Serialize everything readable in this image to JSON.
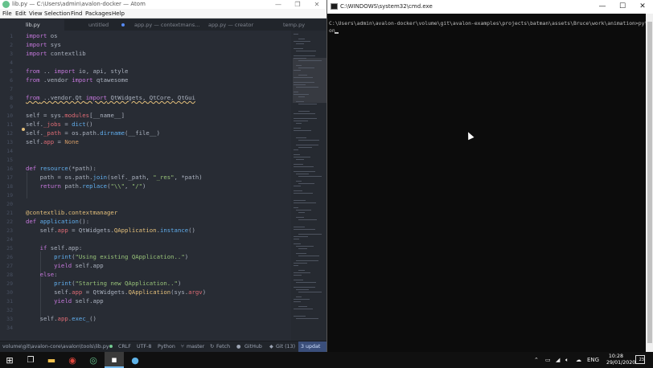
{
  "atom": {
    "title": "lib.py — C:\\Users\\admin\\avalon-docker — Atom",
    "window_controls": [
      "—",
      "❐",
      "✕"
    ],
    "menu": [
      "File",
      "Edit",
      "View",
      "Selection",
      "Find",
      "Packages",
      "Help"
    ],
    "tabs": [
      {
        "label": "lib.py",
        "active": true
      },
      {
        "label": "untitled",
        "active": false
      },
      {
        "label": "app.py — contextmans...",
        "active": false
      },
      {
        "label": "app.py — creator",
        "active": false
      },
      {
        "label": "temp.py",
        "active": false
      }
    ],
    "line_numbers": [
      "1",
      "2",
      "3",
      "4",
      "5",
      "6",
      "7",
      "8",
      "9",
      "10",
      "11",
      "12",
      "13",
      "14",
      "15",
      "16",
      "17",
      "18",
      "19",
      "20",
      "21",
      "22",
      "23",
      "24",
      "25",
      "26",
      "27",
      "28",
      "29",
      "30",
      "31",
      "32",
      "33",
      "34"
    ],
    "code": {
      "l1_kw": "import",
      "l1_rest": " os",
      "l2_kw": "import",
      "l2_rest": " sys",
      "l3_kw": "import",
      "l3_rest": " contextlib",
      "l5_kw1": "from",
      "l5_mid": " .. ",
      "l5_kw2": "import",
      "l5_rest": " io, api, style",
      "l6_kw1": "from",
      "l6_mid": " .vendor ",
      "l6_kw2": "import",
      "l6_rest": " qtawesome",
      "l8_kw1": "from",
      "l8_mid": " ..vendor.Qt ",
      "l8_kw2": "import",
      "l8_rest": " QtWidgets, QtCore, QtGui",
      "l10_a": "self = sys.",
      "l10_b": "modules",
      "l10_c": "[__name__]",
      "l11_a": "self.",
      "l11_b": "_jobs",
      "l11_c": " = ",
      "l11_d": "dict",
      "l11_e": "()",
      "l12_a": "self.",
      "l12_b": "_path",
      "l12_c": " = os.path.",
      "l12_d": "dirname",
      "l12_e": "(__file__)",
      "l13_a": "self.",
      "l13_b": "app",
      "l13_c": " = ",
      "l13_d": "None",
      "l16_kw": "def",
      "l16_fn": " resource",
      "l16_rest": "(*path):",
      "l17_a": "    path = os.path.",
      "l17_b": "join",
      "l17_c": "(self._path, ",
      "l17_d": "\"_res\"",
      "l17_e": ", *path)",
      "l18_kw": "    return",
      "l18_a": " path.",
      "l18_b": "replace",
      "l18_c": "(",
      "l18_d": "\"\\\\\"",
      "l18_e": ", ",
      "l18_f": "\"/\"",
      "l18_g": ")",
      "l21_a": "@contextlib.contextmanager",
      "l22_kw": "def",
      "l22_fn": " application",
      "l22_rest": "():",
      "l23_a": "    self.",
      "l23_b": "app",
      "l23_c": " = QtWidgets.",
      "l23_d": "QApplication",
      "l23_e": ".",
      "l23_f": "instance",
      "l23_g": "()",
      "l25_kw": "    if",
      "l25_rest": " self.app:",
      "l26_a": "        ",
      "l26_fn": "print",
      "l26_b": "(",
      "l26_s": "\"Using existing QApplication..\"",
      "l26_c": ")",
      "l27_kw": "        yield",
      "l27_rest": " self.app",
      "l28_kw": "    else",
      "l28_rest": ":",
      "l29_a": "        ",
      "l29_fn": "print",
      "l29_b": "(",
      "l29_s": "\"Starting new QApplication..\"",
      "l29_c": ")",
      "l30_a": "        self.",
      "l30_b": "app",
      "l30_c": " = QtWidgets.",
      "l30_d": "QApplication",
      "l30_e": "(sys.",
      "l30_f": "argv",
      "l30_g": ")",
      "l31_kw": "        yield",
      "l31_rest": " self.app",
      "l33_a": "    self.",
      "l33_b": "app",
      "l33_c": ".",
      "l33_d": "exec_",
      "l33_e": "()"
    },
    "status": {
      "path": "volume\\git\\avalon-core\\avalon\\tools\\lib.py",
      "line_ending": "CRLF",
      "encoding": "UTF-8",
      "grammar": "Python",
      "branch": "master",
      "fetch": "Fetch",
      "github": "GitHub",
      "git": "Git (13)",
      "updates": "3 updat"
    }
  },
  "cmd": {
    "title": "C:\\WINDOWS\\system32\\cmd.exe",
    "window_controls": [
      "—",
      "☐",
      "✕"
    ],
    "prompt_line": "C:\\Users\\admin\\avalon-docker\\volume\\git\\avalon-examples\\projects\\batman\\assets\\Bruce\\work\\animation>pyth",
    "prompt_line2": "on"
  },
  "taskbar": {
    "start_icon": "windows-start-icon",
    "tray": {
      "language": "ENG",
      "time": "10:28",
      "date": "29/01/2020",
      "notifications": "23"
    }
  },
  "colors": {
    "atom_bg": "#282c34",
    "keyword": "#c678dd",
    "function": "#61afef",
    "string": "#98c379",
    "class": "#e5c07b",
    "constant": "#d19a66",
    "property": "#e06c75",
    "cmd_bg": "#0c0c0c",
    "taskbar_bg": "#101010"
  }
}
